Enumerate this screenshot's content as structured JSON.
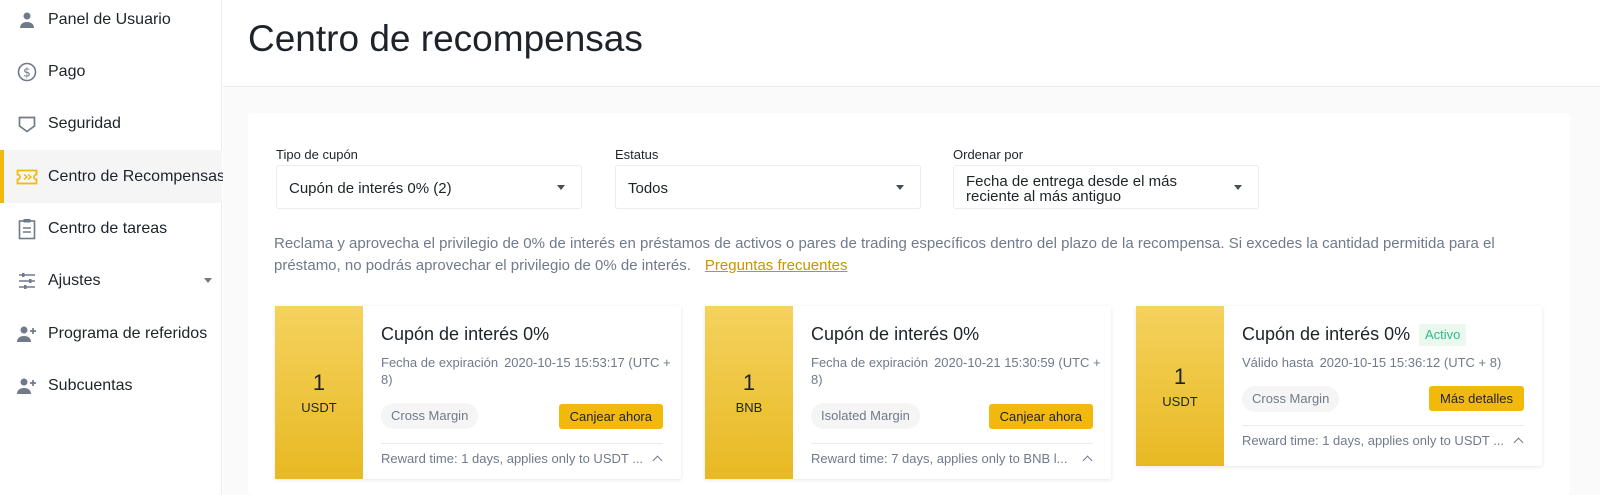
{
  "sidebar": {
    "items": [
      {
        "label": "Panel de Usuario",
        "icon": "user-icon"
      },
      {
        "label": "Pago",
        "icon": "dollar-circle-icon"
      },
      {
        "label": "Seguridad",
        "icon": "shield-icon"
      },
      {
        "label": "Centro de Recompensas",
        "icon": "ticket-icon",
        "active": true
      },
      {
        "label": "Centro de tareas",
        "icon": "clipboard-icon"
      },
      {
        "label": "Ajustes",
        "icon": "sliders-icon"
      },
      {
        "label": "Programa de referidos",
        "icon": "user-plus-icon"
      },
      {
        "label": "Subcuentas",
        "icon": "user-plus-icon"
      }
    ]
  },
  "header": {
    "title": "Centro de recompensas"
  },
  "filters": {
    "coupon_type": {
      "label": "Tipo de cupón",
      "value": "Cupón de interés 0% (2)"
    },
    "status": {
      "label": "Estatus",
      "value": "Todos"
    },
    "sort": {
      "label": "Ordenar por",
      "value_line1": "Fecha de entrega desde el más",
      "value_line2": "reciente al más antiguo"
    }
  },
  "description": {
    "text": "Reclama y aprovecha el privilegio de 0% de interés en préstamos de activos o pares de trading específicos dentro del plazo de la recompensa. Si excedes la cantidad permitida para el préstamo, no podrás aprovechar el privilegio de 0% de interés.",
    "faq_link": "Preguntas frecuentes"
  },
  "coupons": [
    {
      "amount": "1",
      "currency": "USDT",
      "title": "Cupón de interés 0%",
      "date_label": "Fecha de expiración",
      "date_value": "2020-10-15 15:53:17 (UTC + 8)",
      "tag": "Cross Margin",
      "button": "Canjear ahora",
      "reward": "Reward time: 1 days, applies only to USDT ..."
    },
    {
      "amount": "1",
      "currency": "BNB",
      "title": "Cupón de interés 0%",
      "date_label": "Fecha de expiración",
      "date_value": "2020-10-21 15:30:59 (UTC + 8)",
      "tag": "Isolated Margin",
      "button": "Canjear ahora",
      "reward": "Reward time: 7 days, applies only to BNB l..."
    },
    {
      "amount": "1",
      "currency": "USDT",
      "title": "Cupón de interés 0%",
      "badge": "Activo",
      "date_label": "Válido hasta",
      "date_value": "2020-10-15 15:36:12 (UTC + 8)",
      "tag": "Cross Margin",
      "button": "Más detalles",
      "reward": "Reward time: 1 days, applies only to USDT ..."
    }
  ],
  "colors": {
    "accent": "#f0b90b",
    "text": "#1e2329",
    "muted": "#707a8a",
    "success": "#2ebd85"
  }
}
